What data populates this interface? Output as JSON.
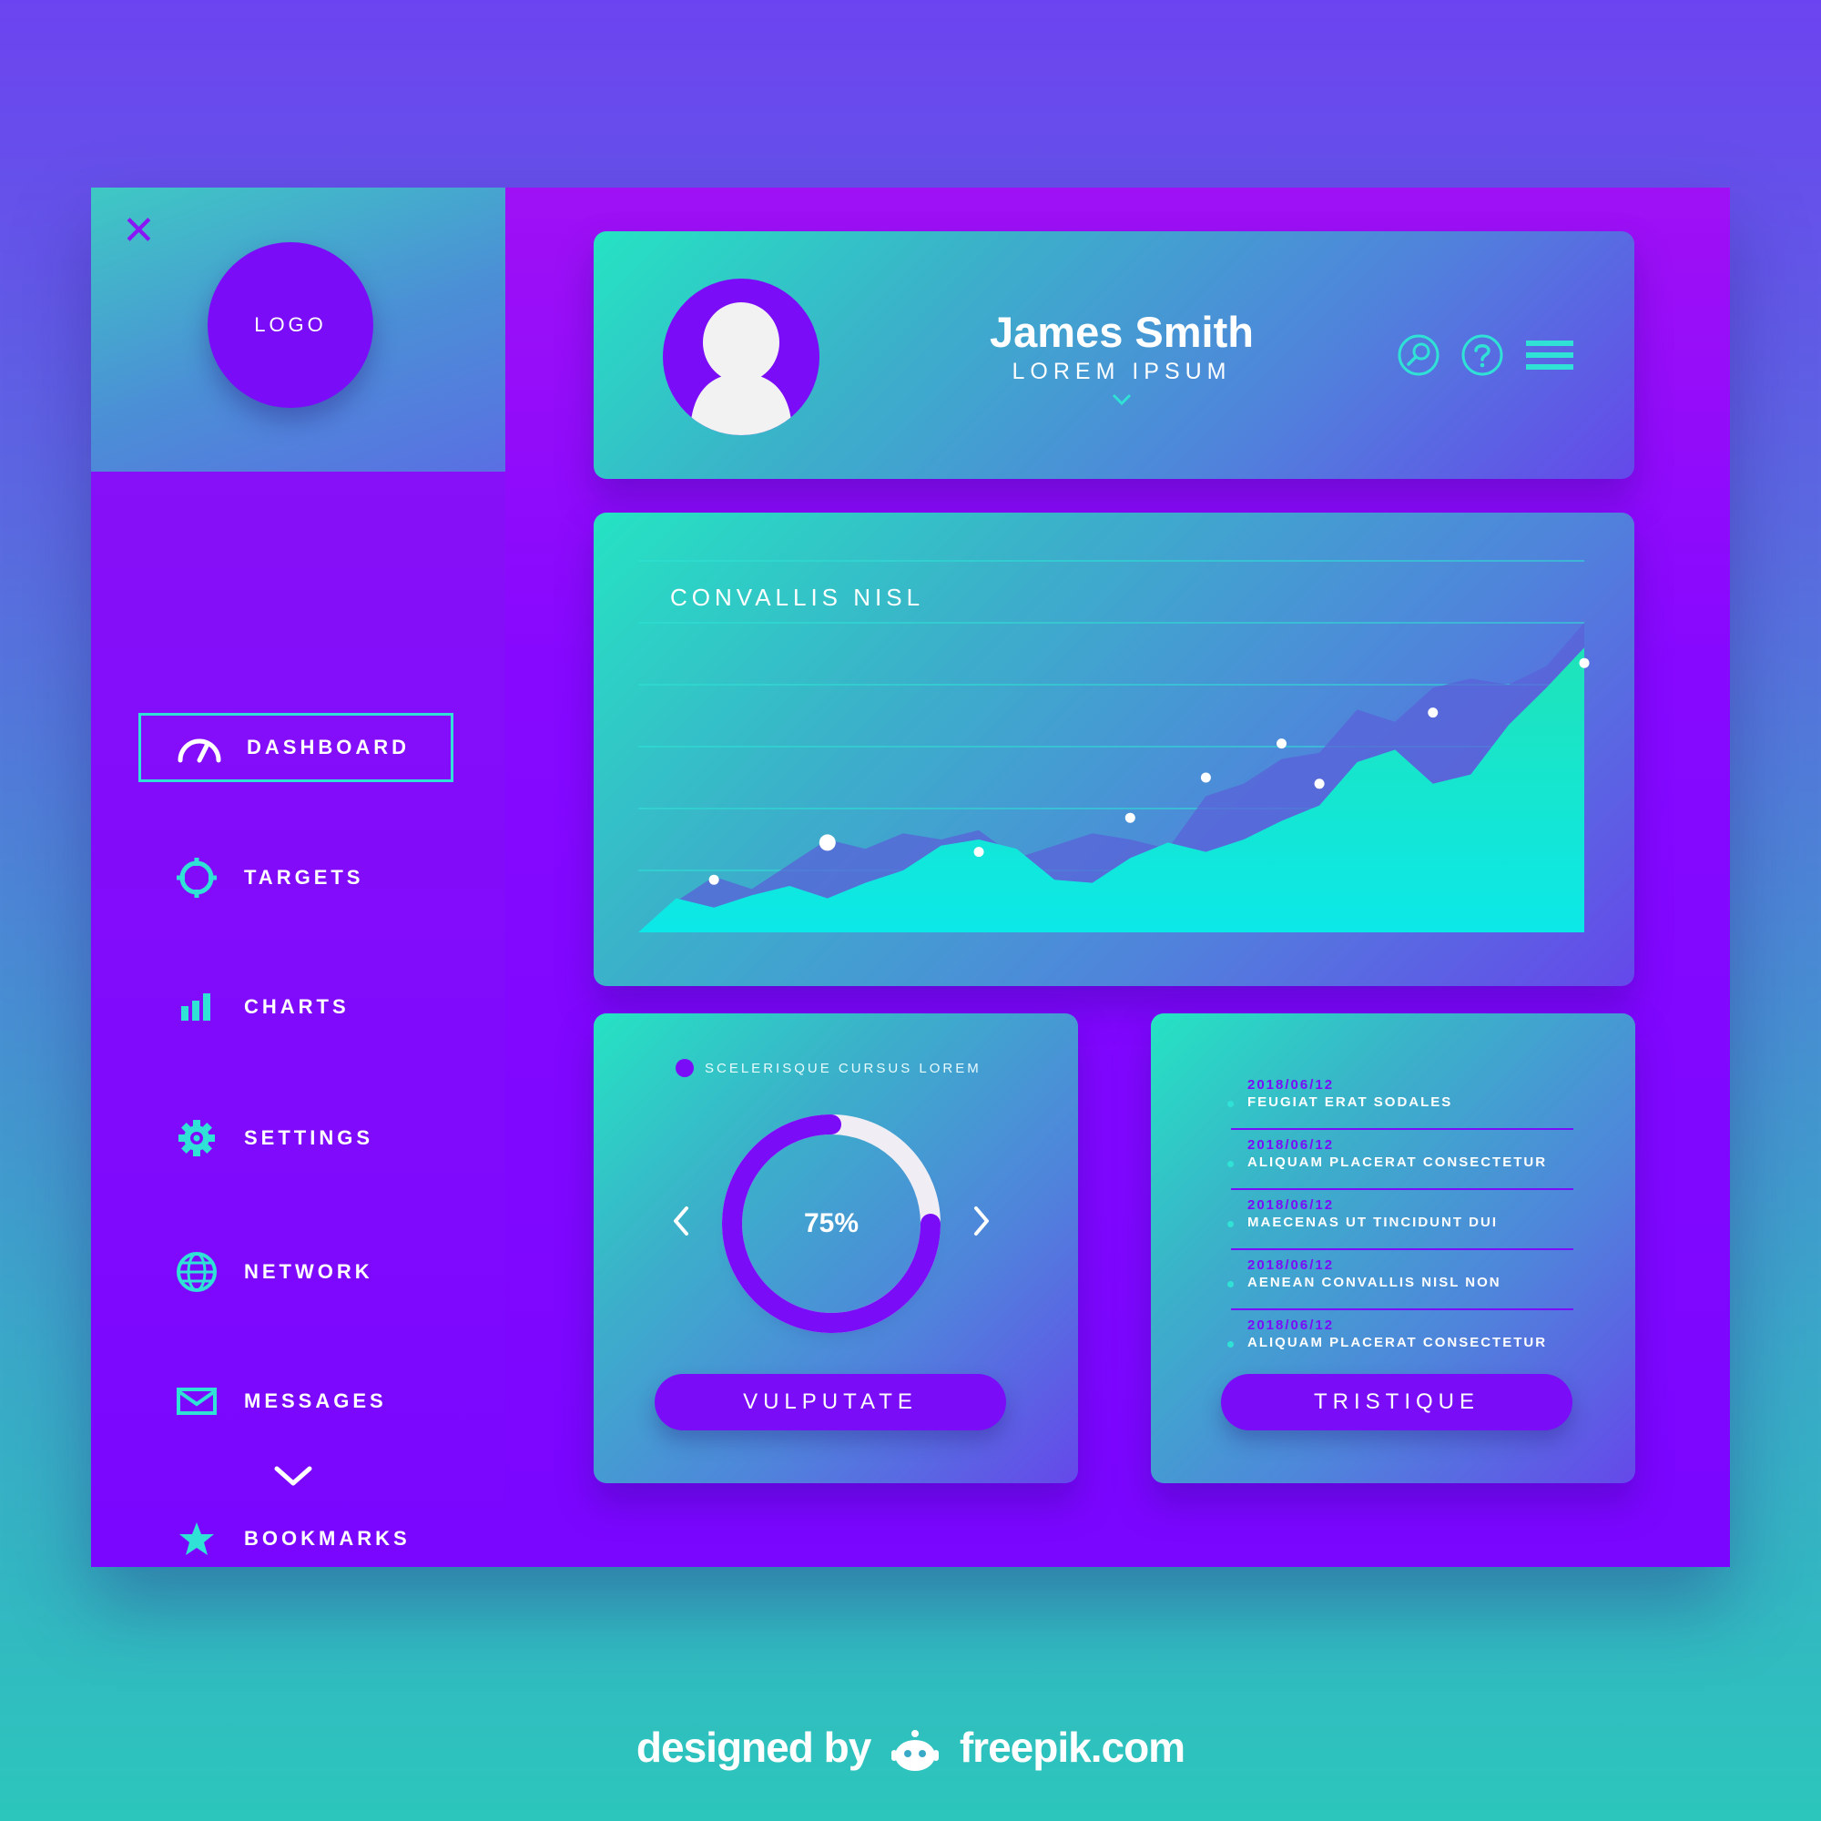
{
  "colors": {
    "accent": "#2fe2d5",
    "brand_purple": "#7b0cf7",
    "sidebar": "#8206ff",
    "card_gradient_start": "#25e3c3",
    "card_gradient_end": "#6548ea"
  },
  "sidebar": {
    "logo_label": "LOGO",
    "close_icon": "close-icon",
    "items": [
      {
        "label": "DASHBOARD",
        "icon": "speedometer-icon",
        "active": true
      },
      {
        "label": "TARGETS",
        "icon": "target-icon",
        "active": false
      },
      {
        "label": "CHARTS",
        "icon": "bar-chart-icon",
        "active": false
      },
      {
        "label": "SETTINGS",
        "icon": "gear-icon",
        "active": false
      },
      {
        "label": "NETWORK",
        "icon": "globe-icon",
        "active": false
      },
      {
        "label": "MESSAGES",
        "icon": "envelope-icon",
        "active": false
      },
      {
        "label": "BOOKMARKS",
        "icon": "star-icon",
        "active": false
      }
    ],
    "expand_icon": "chevron-down-icon"
  },
  "profile": {
    "name": "James Smith",
    "role": "LOREM IPSUM",
    "actions": [
      "search-icon",
      "help-icon",
      "menu-icon"
    ]
  },
  "chart": {
    "title": "CONVALLIS NISL"
  },
  "chart_data": {
    "type": "area",
    "title": "CONVALLIS NISL",
    "xlabel": "",
    "ylabel": "",
    "grid": true,
    "ylim": [
      0,
      6
    ],
    "x": [
      0,
      1,
      2,
      3,
      4,
      5,
      6,
      7,
      8,
      9,
      10,
      11,
      12,
      13,
      14,
      15,
      16,
      17,
      18,
      19,
      20,
      21,
      22,
      23,
      24,
      25
    ],
    "series": [
      {
        "values": [
          0.0,
          0.55,
          0.4,
          0.6,
          0.75,
          0.55,
          0.8,
          1.0,
          1.4,
          1.5,
          1.35,
          0.85,
          0.8,
          1.2,
          1.45,
          1.3,
          1.5,
          1.8,
          2.05,
          2.75,
          2.95,
          2.4,
          2.55,
          3.35,
          3.95,
          4.6
        ]
      },
      {
        "values": [
          0.0,
          0.5,
          0.9,
          0.7,
          1.1,
          1.5,
          1.35,
          1.6,
          1.5,
          1.65,
          1.2,
          1.4,
          1.6,
          1.5,
          1.35,
          2.2,
          2.4,
          2.8,
          2.9,
          3.6,
          3.4,
          3.95,
          4.1,
          4.0,
          4.3,
          5.0
        ]
      }
    ],
    "markers": [
      {
        "x": 2,
        "y": 0.85
      },
      {
        "x": 5,
        "y": 1.45
      },
      {
        "x": 9,
        "y": 1.3
      },
      {
        "x": 13,
        "y": 1.85
      },
      {
        "x": 15,
        "y": 2.5
      },
      {
        "x": 17,
        "y": 3.05
      },
      {
        "x": 18,
        "y": 2.4
      },
      {
        "x": 21,
        "y": 3.55
      },
      {
        "x": 25,
        "y": 4.35
      }
    ]
  },
  "progress": {
    "legend": "SCELERISQUE CURSUS LOREM",
    "value": 0.75,
    "label": "75%",
    "prev_icon": "chevron-left-icon",
    "next_icon": "chevron-right-icon",
    "button": "VULPUTATE"
  },
  "timeline": {
    "items": [
      {
        "date": "2018/06/12",
        "text": "FEUGIAT ERAT SODALES"
      },
      {
        "date": "2018/06/12",
        "text": "ALIQUAM PLACERAT CONSECTETUR"
      },
      {
        "date": "2018/06/12",
        "text": "MAECENAS UT TINCIDUNT DUI"
      },
      {
        "date": "2018/06/12",
        "text": "AENEAN CONVALLIS NISL NON"
      },
      {
        "date": "2018/06/12",
        "text": "ALIQUAM PLACERAT CONSECTETUR"
      }
    ],
    "button": "TRISTIQUE"
  },
  "credit": {
    "prefix": "designed by",
    "site": "freepik.com"
  }
}
